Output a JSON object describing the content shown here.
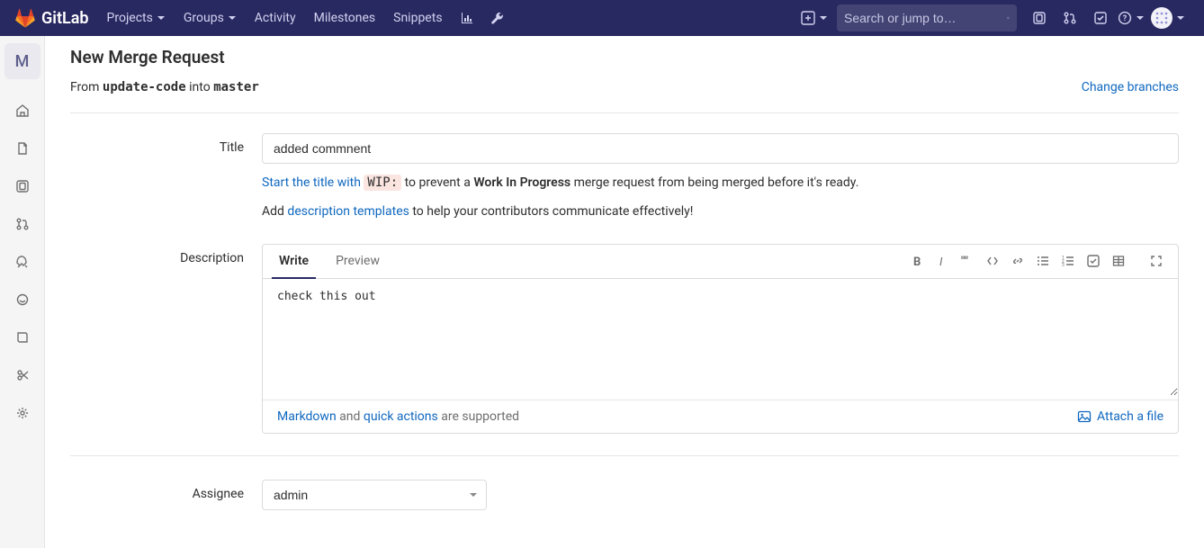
{
  "nav": {
    "brand": "GitLab",
    "items": [
      "Projects",
      "Groups",
      "Activity",
      "Milestones",
      "Snippets"
    ],
    "search_placeholder": "Search or jump to…"
  },
  "sidebar": {
    "project_letter": "M"
  },
  "page": {
    "title": "New Merge Request",
    "from_word": "From",
    "from_branch": "update-code",
    "into_word": "into",
    "to_branch": "master",
    "change_branches": "Change branches"
  },
  "title_field": {
    "label": "Title",
    "value": "added commnent",
    "wip_hint_prefix": "Start the title with",
    "wip_code": "WIP:",
    "wip_hint_mid": "to prevent a",
    "wip_bold": "Work In Progress",
    "wip_hint_suffix": "merge request from being merged before it's ready.",
    "tmpl_prefix": "Add",
    "tmpl_link": "description templates",
    "tmpl_suffix": "to help your contributors communicate effectively!"
  },
  "desc": {
    "label": "Description",
    "tab_write": "Write",
    "tab_preview": "Preview",
    "value": "check this out",
    "markdown_link": "Markdown",
    "and_word": "and",
    "quick_link": "quick actions",
    "supported": "are supported",
    "attach": "Attach a file"
  },
  "assignee": {
    "label": "Assignee",
    "value": "admin"
  }
}
